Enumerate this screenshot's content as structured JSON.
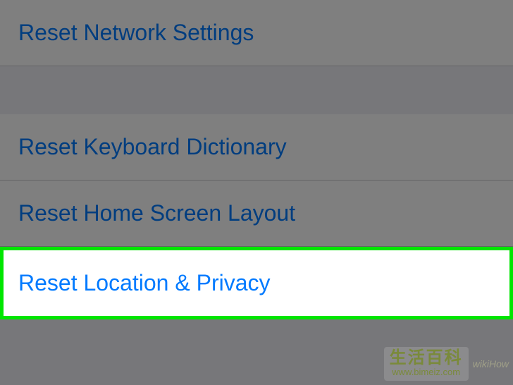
{
  "settings": {
    "items": [
      {
        "label": "Reset Network Settings"
      },
      {
        "label": "Reset Keyboard Dictionary"
      },
      {
        "label": "Reset Home Screen Layout"
      },
      {
        "label": "Reset Location & Privacy"
      }
    ]
  },
  "watermark": {
    "chinese": "生活百科",
    "url": "www.bimeiz.com",
    "source": "wikiHow"
  }
}
